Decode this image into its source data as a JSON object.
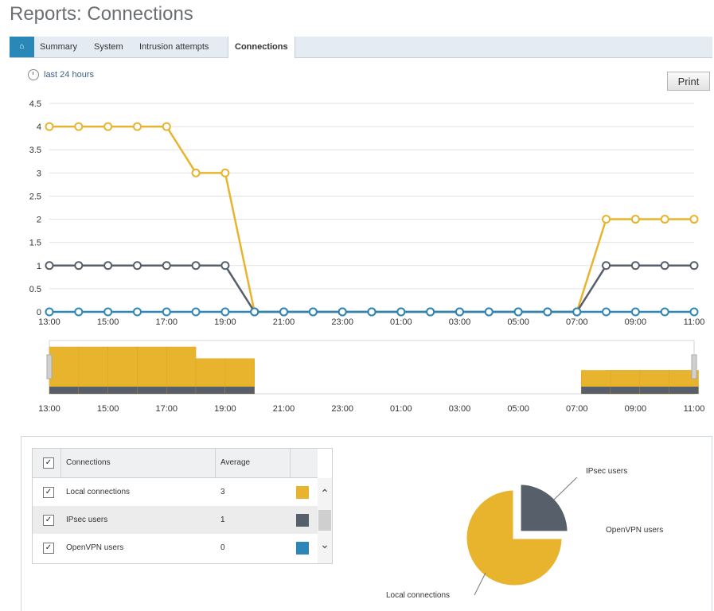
{
  "page": {
    "title": "Reports: Connections"
  },
  "tabs": {
    "home_icon": "home-icon",
    "items": [
      {
        "label": "Summary",
        "active": false
      },
      {
        "label": "System",
        "active": false
      },
      {
        "label": "Intrusion attempts",
        "active": false
      },
      {
        "label": "Connections",
        "active": true
      }
    ]
  },
  "toolbar": {
    "range_label": "last 24 hours",
    "print_label": "Print"
  },
  "colors": {
    "local": "#e9b42d",
    "ipsec": "#575f6b",
    "openvpn": "#2e86b8",
    "grid": "#e2e2e2",
    "tab_active_bg": "#ffffff",
    "home_tab": "#2a88b8"
  },
  "chart_data": {
    "type": "line",
    "x": [
      "13:00",
      "14:00",
      "15:00",
      "16:00",
      "17:00",
      "18:00",
      "19:00",
      "20:00",
      "21:00",
      "22:00",
      "23:00",
      "00:00",
      "01:00",
      "02:00",
      "03:00",
      "04:00",
      "05:00",
      "06:00",
      "07:00",
      "08:00",
      "09:00",
      "10:00",
      "11:00"
    ],
    "x_tick_labels": [
      "13:00",
      "15:00",
      "17:00",
      "19:00",
      "21:00",
      "23:00",
      "01:00",
      "03:00",
      "05:00",
      "07:00",
      "09:00",
      "11:00"
    ],
    "y_ticks": [
      "0",
      "0.5",
      "1",
      "1.5",
      "2",
      "2.5",
      "3",
      "3.5",
      "4",
      "4.5"
    ],
    "ylim": [
      0,
      4.5
    ],
    "grid": true,
    "series": [
      {
        "name": "Local connections",
        "color": "#e9b42d",
        "values": [
          4,
          4,
          4,
          4,
          4,
          3,
          3,
          0,
          0,
          0,
          0,
          0,
          0,
          0,
          0,
          0,
          0,
          0,
          0,
          2,
          2,
          2,
          2
        ]
      },
      {
        "name": "IPsec users",
        "color": "#575f6b",
        "values": [
          1,
          1,
          1,
          1,
          1,
          1,
          1,
          0,
          0,
          0,
          0,
          0,
          0,
          0,
          0,
          0,
          0,
          0,
          0,
          1,
          1,
          1,
          1
        ]
      },
      {
        "name": "OpenVPN users",
        "color": "#2e86b8",
        "values": [
          0,
          0,
          0,
          0,
          0,
          0,
          0,
          0,
          0,
          0,
          0,
          0,
          0,
          0,
          0,
          0,
          0,
          0,
          0,
          0,
          0,
          0,
          0
        ]
      }
    ]
  },
  "overview": {
    "x_tick_labels": [
      "13:00",
      "15:00",
      "17:00",
      "19:00",
      "21:00",
      "23:00",
      "01:00",
      "03:00",
      "05:00",
      "07:00",
      "09:00",
      "11:00"
    ]
  },
  "legend_table": {
    "headers": {
      "connections": "Connections",
      "average": "Average"
    },
    "rows": [
      {
        "name": "Local connections",
        "average": "3",
        "checked": true,
        "color": "#e9b42d"
      },
      {
        "name": "IPsec users",
        "average": "1",
        "checked": true,
        "color": "#575f6b"
      },
      {
        "name": "OpenVPN users",
        "average": "0",
        "checked": true,
        "color": "#2e86b8"
      }
    ]
  },
  "pie": {
    "type": "pie",
    "slices": [
      {
        "label": "Local connections",
        "value": 3,
        "color": "#e9b42d"
      },
      {
        "label": "IPsec users",
        "value": 1,
        "color": "#575f6b"
      },
      {
        "label": "OpenVPN users",
        "value": 0,
        "color": "#2e86b8"
      }
    ]
  }
}
